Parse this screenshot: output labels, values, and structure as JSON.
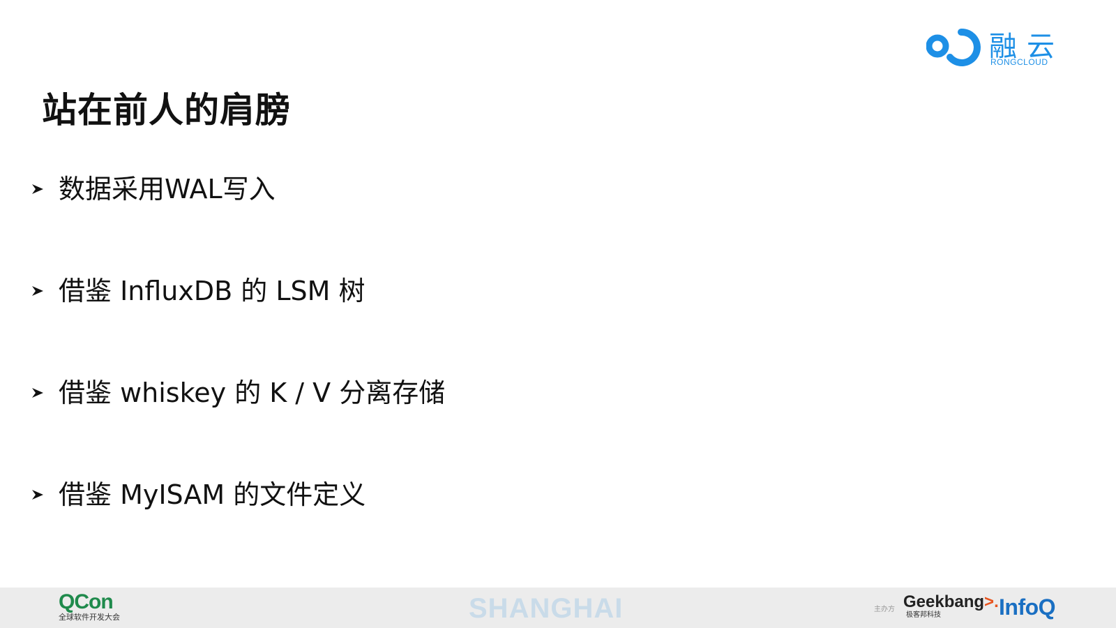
{
  "slide": {
    "title": "站在前人的肩膀",
    "bullets": [
      "数据采用WAL写入",
      "借鉴 InfluxDB 的 LSM 树",
      "借鉴 whiskey 的 K / V 分离存储",
      "借鉴 MyISAM 的文件定义"
    ]
  },
  "logo": {
    "cn": "融云",
    "en": "RONGCLOUD",
    "color": "#1d8fe6"
  },
  "footer": {
    "qcon": {
      "name": "QCon",
      "subtitle": "全球软件开发大会"
    },
    "city": "SHANGHAI",
    "organizer_label": "主办方",
    "geekbang": {
      "name": "Geekbang",
      "chevron": ">.",
      "subtitle": "极客邦科技"
    },
    "infoq": "InfoQ"
  },
  "icons": {
    "bullet": "arrow-bullet-icon",
    "logo_mark": "rongcloud-logo-mark-icon"
  }
}
